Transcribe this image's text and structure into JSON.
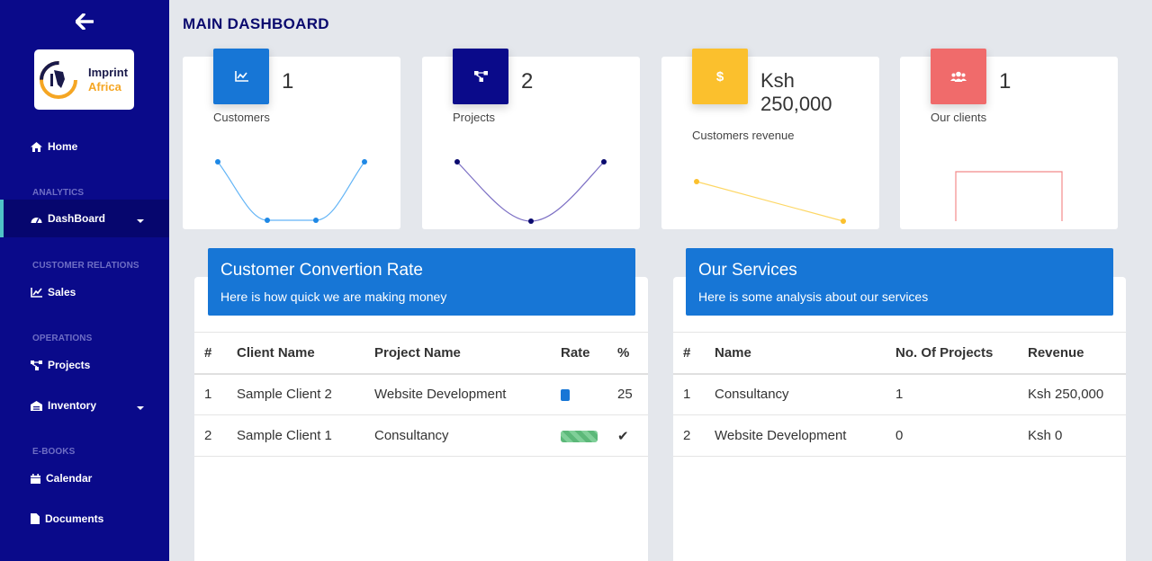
{
  "sidebar": {
    "logo": {
      "line1": "Imprint",
      "line2": "Africa"
    },
    "home": "Home",
    "sections": {
      "analytics": "ANALYTICS",
      "customer_relations": "CUSTOMER RELATIONS",
      "operations": "OPERATIONS",
      "ebooks": "E-BOOKS"
    },
    "items": {
      "dashboard": "DashBoard",
      "sales": "Sales",
      "projects": "Projects",
      "inventory": "Inventory",
      "calendar": "Calendar",
      "documents": "Documents"
    }
  },
  "header": {
    "title": "MAIN DASHBOARD"
  },
  "stats": [
    {
      "value": "1",
      "label": "Customers",
      "color": "#1776d6",
      "icon": "chart-line-icon"
    },
    {
      "value": "2",
      "label": "Projects",
      "color": "#0a0a8a",
      "icon": "sitemap-icon"
    },
    {
      "value_line1": "Ksh",
      "value_line2": "250,000",
      "label": "Customers revenue",
      "color": "#fbc02d",
      "icon": "dollar-icon"
    },
    {
      "value": "1",
      "label": "Our clients",
      "color": "#f06b6b",
      "icon": "users-icon"
    }
  ],
  "conversion": {
    "title": "Customer Convertion Rate",
    "subtitle": "Here is how quick we are making money",
    "columns": [
      "#",
      "Client Name",
      "Project Name",
      "Rate",
      "%"
    ],
    "rows": [
      {
        "n": "1",
        "client": "Sample Client 2",
        "project": "Website Development",
        "rate": 0.25,
        "pct": "25"
      },
      {
        "n": "2",
        "client": "Sample Client 1",
        "project": "Consultancy",
        "rate": 1.0,
        "pct": "✔"
      }
    ]
  },
  "services": {
    "title": "Our Services",
    "subtitle": "Here is some analysis about our services",
    "columns": [
      "#",
      "Name",
      "No. Of Projects",
      "Revenue"
    ],
    "rows": [
      {
        "n": "1",
        "name": "Consultancy",
        "projects": "1",
        "revenue": "Ksh 250,000"
      },
      {
        "n": "2",
        "name": "Website Development",
        "projects": "0",
        "revenue": "Ksh 0"
      }
    ]
  }
}
